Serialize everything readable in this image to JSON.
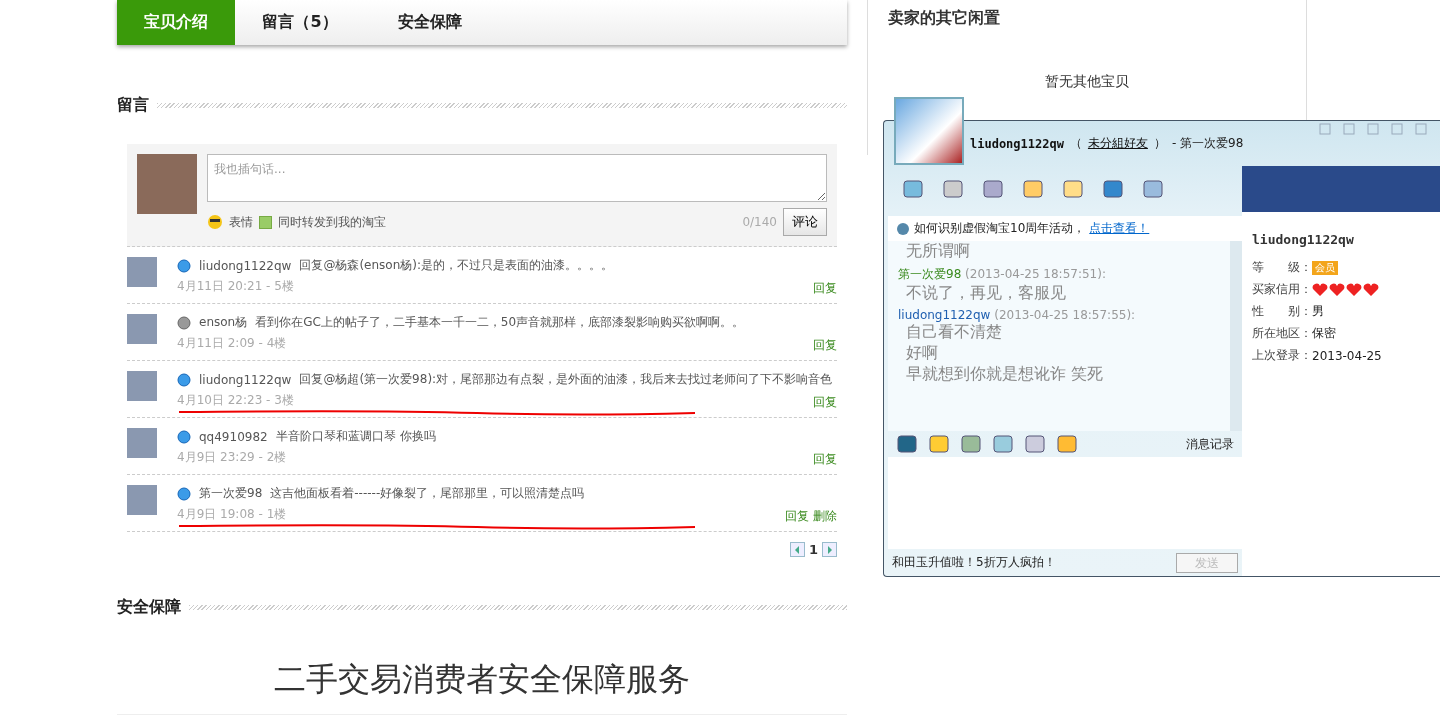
{
  "tabs": [
    {
      "label": "宝贝介绍",
      "selected": true
    },
    {
      "label": "留言（5）",
      "selected": false
    },
    {
      "label": "安全保障",
      "selected": false
    }
  ],
  "comments_section": {
    "heading": "留言"
  },
  "composer": {
    "placeholder": "我也插句话...",
    "emoji_label": "表情",
    "forward_label": "同时转发到我的淘宝",
    "forward_checked": true,
    "counter": "0/140",
    "submit": "评论"
  },
  "comments": [
    {
      "online": true,
      "user": "liudong1122qw",
      "text": "回复@杨森(enson杨):是的，不过只是表面的油漆。。。。",
      "meta": "4月11日 20:21 - 5楼",
      "actions": [
        "回复"
      ],
      "marked": false
    },
    {
      "online": false,
      "user": "enson杨",
      "text": "看到你在GC上的帖子了，二手基本一千一二，50声音就那样，底部漆裂影响购买欲啊啊。。",
      "meta": "4月11日 2:09 - 4楼",
      "actions": [
        "回复"
      ],
      "marked": false
    },
    {
      "online": true,
      "user": "liudong1122qw",
      "text": "回复@杨超(第一次爱98):对，尾部那边有点裂，是外面的油漆，我后来去找过老师问了下不影响音色",
      "meta": "4月10日 22:23 - 3楼",
      "actions": [
        "回复"
      ],
      "marked": true
    },
    {
      "online": true,
      "user": "qq4910982",
      "text": "半音阶口琴和蓝调口琴 你换吗",
      "meta": "4月9日 23:29 - 2楼",
      "actions": [
        "回复"
      ],
      "marked": false
    },
    {
      "online": true,
      "user": "第一次爱98",
      "text": "这吉他面板看着------好像裂了，尾部那里，可以照清楚点吗",
      "meta": "4月9日 19:08 - 1楼",
      "actions": [
        "回复",
        "删除"
      ],
      "marked": true
    }
  ],
  "pagination": {
    "current": "1"
  },
  "safety": {
    "heading": "安全保障",
    "title": "二手交易消费者安全保障服务"
  },
  "seller_other": {
    "title": "卖家的其它闲置",
    "empty": "暂无其他宝贝"
  },
  "chat": {
    "contact": "liudong1122qw",
    "group_open": "（",
    "group": "未分組好友",
    "group_close": "）",
    "title_suffix": "- 第一次爱98",
    "notice": "如何识别虚假淘宝10周年活动，",
    "notice_link": "点击查看！",
    "messages": [
      {
        "lines": [
          "无所谓啊"
        ]
      },
      {
        "sender": "第一次爱98",
        "time": "(2013-04-25 18:57:51):",
        "color": "#3a8a1e",
        "lines": [
          "不说了，再见，客服见"
        ]
      },
      {
        "sender": "liudong1122qw",
        "time": "(2013-04-25 18:57:55):",
        "color": "#1f5fb0",
        "lines": [
          "自己看不清楚",
          "好啊",
          "早就想到你就是想讹诈  笑死"
        ]
      }
    ],
    "history": "消息记录",
    "ad": "和田玉升值啦！5折万人疯拍！",
    "send": "发送",
    "send_disabled": true,
    "profile": {
      "name": "liudong1122qw",
      "fields": [
        {
          "kind": "badge",
          "label": "等　　级：",
          "value": "会员"
        },
        {
          "kind": "hearts",
          "label": "买家信用：",
          "stars": 4
        },
        {
          "kind": "text",
          "label": "性　　别：",
          "value": "男"
        },
        {
          "kind": "text",
          "label": "所在地区：",
          "value": "保密"
        },
        {
          "kind": "text",
          "label": "上次登录：",
          "value": "2013-04-25"
        }
      ]
    }
  }
}
